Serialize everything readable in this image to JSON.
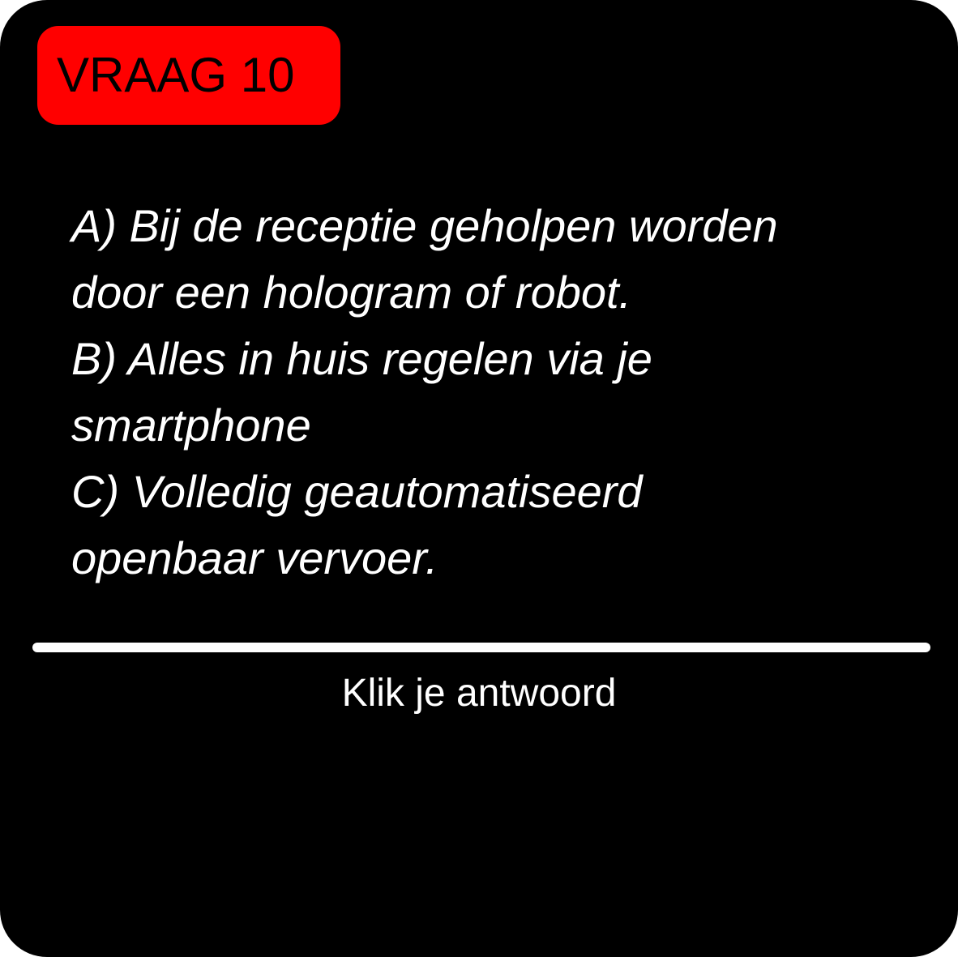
{
  "question": {
    "badge_label": "VRAAG 10",
    "colors": {
      "badge_background": "#ff0000",
      "card_background": "#000000",
      "text": "#ffffff"
    }
  },
  "options": [
    {
      "lines": [
        "A) Bij de receptie geholpen worden",
        "door een hologram of robot."
      ]
    },
    {
      "lines": [
        "B) Alles in huis regelen via je",
        "smartphone"
      ]
    },
    {
      "lines": [
        "C) Volledig geautomatiseerd",
        "openbaar vervoer."
      ]
    }
  ],
  "footer": {
    "instruction": "Klik je antwoord"
  }
}
